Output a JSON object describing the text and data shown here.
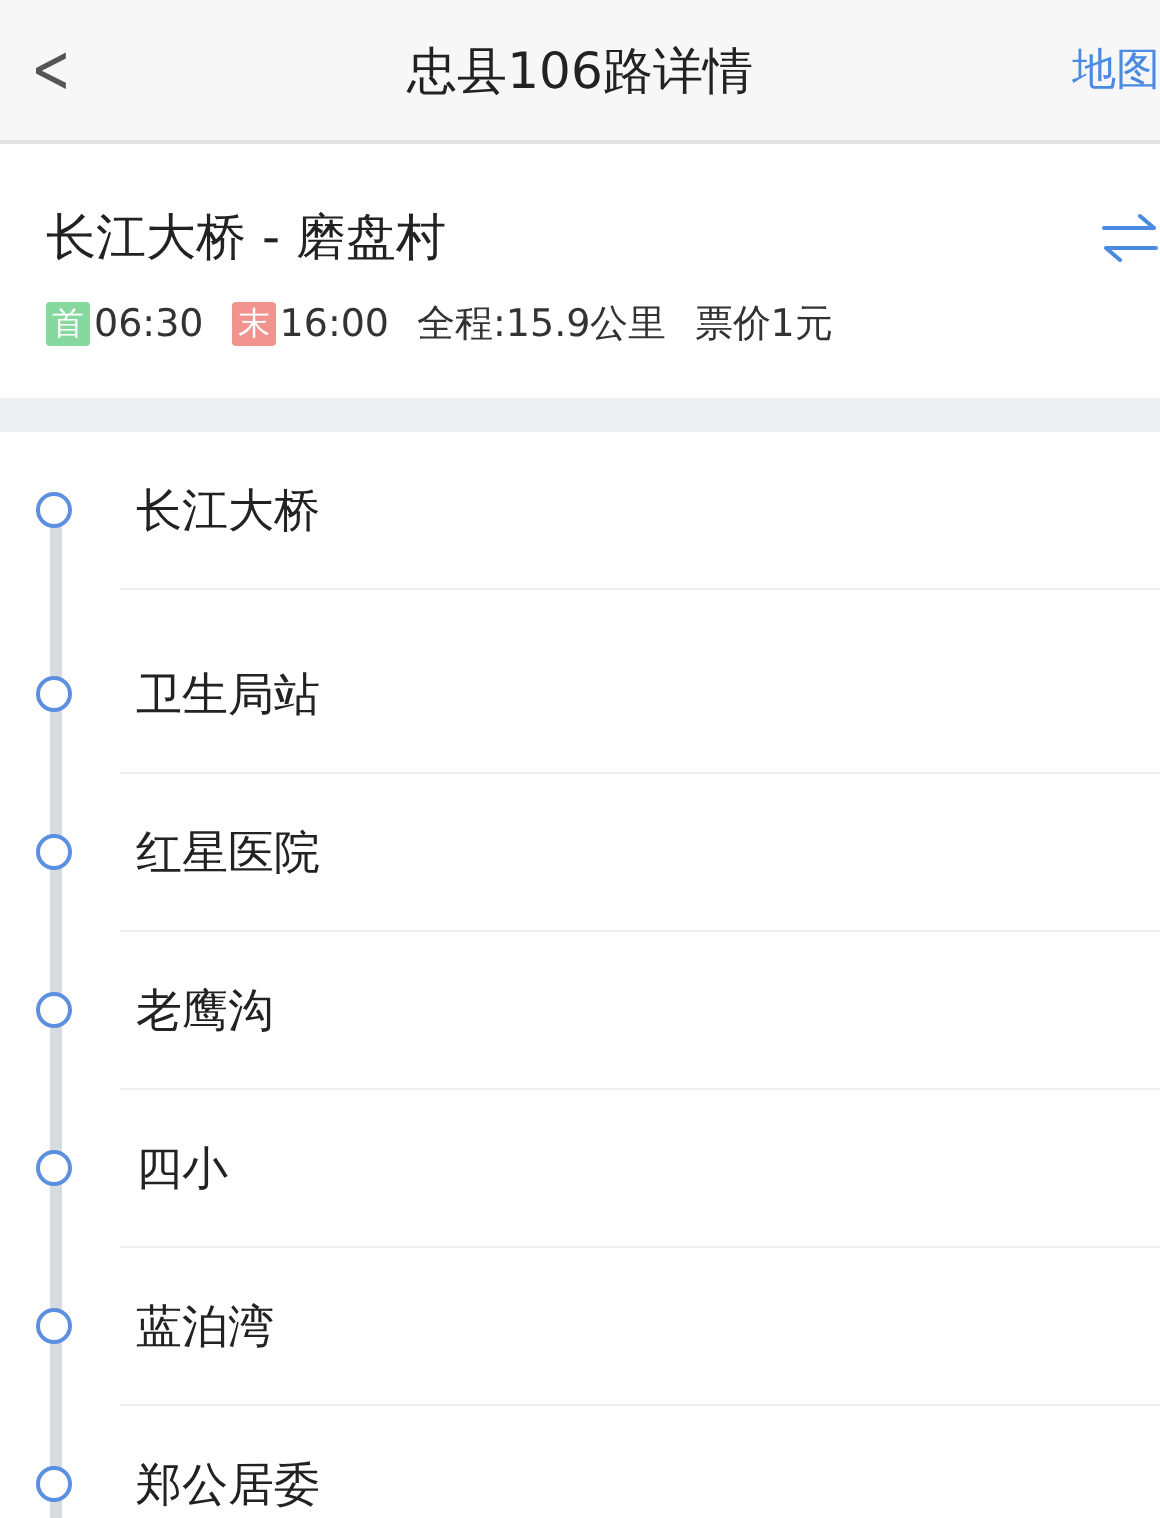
{
  "header": {
    "back": "<",
    "title": "忠县106路详情",
    "map_link": "地图"
  },
  "route": {
    "name": "长江大桥 - 磨盘村",
    "first_tag": "首",
    "first_time": "06:30",
    "last_tag": "末",
    "last_time": "16:00",
    "distance": "全程:15.9公里",
    "fare": "票价1元"
  },
  "stops": [
    {
      "name": "长江大桥"
    },
    {
      "name": "卫生局站"
    },
    {
      "name": "红星医院"
    },
    {
      "name": "老鹰沟"
    },
    {
      "name": "四小"
    },
    {
      "name": "蓝泊湾"
    },
    {
      "name": "郑公居委"
    }
  ]
}
